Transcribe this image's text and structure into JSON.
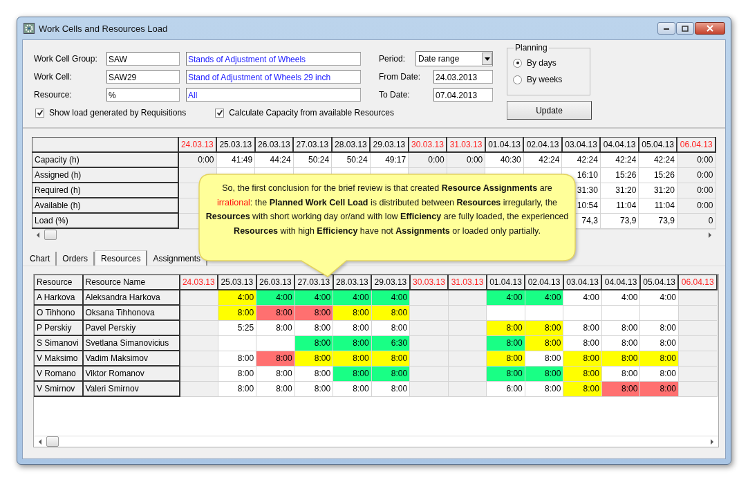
{
  "window": {
    "title": "Work Cells and Resources Load"
  },
  "filters": [
    {
      "label": "Work Cell Group:",
      "code": "SAW",
      "description": "Stands of Adjustment of Wheels"
    },
    {
      "label": "Work Cell:",
      "code": "SAW29",
      "description": "Stand of Adjustment of Wheels 29 inch"
    },
    {
      "label": "Resource:",
      "code": "%",
      "description": "All"
    }
  ],
  "checkboxes": [
    {
      "label": "Show load generated by Requisitions",
      "checked": true
    },
    {
      "label": "Calculate Capacity from available Resources",
      "checked": true
    }
  ],
  "period": {
    "label": "Period:",
    "value": "Date range"
  },
  "dates": [
    {
      "label": "From Date:",
      "value": "24.03.2013"
    },
    {
      "label": "To Date:",
      "value": "07.04.2013"
    }
  ],
  "planning": {
    "title": "Planning",
    "options": [
      {
        "label": "By days",
        "selected": true
      },
      {
        "label": "By weeks",
        "selected": false
      }
    ]
  },
  "update_button": "Update",
  "summary_grid": {
    "columns": [
      {
        "date": "24.03.13",
        "weekend": true
      },
      {
        "date": "25.03.13",
        "weekend": false
      },
      {
        "date": "26.03.13",
        "weekend": false
      },
      {
        "date": "27.03.13",
        "weekend": false
      },
      {
        "date": "28.03.13",
        "weekend": false
      },
      {
        "date": "29.03.13",
        "weekend": false
      },
      {
        "date": "30.03.13",
        "weekend": true
      },
      {
        "date": "31.03.13",
        "weekend": true
      },
      {
        "date": "01.04.13",
        "weekend": false
      },
      {
        "date": "02.04.13",
        "weekend": false
      },
      {
        "date": "03.04.13",
        "weekend": false
      },
      {
        "date": "04.04.13",
        "weekend": false
      },
      {
        "date": "05.04.13",
        "weekend": false
      },
      {
        "date": "06.04.13",
        "weekend": true
      }
    ],
    "rows": [
      {
        "label": "Capacity (h)",
        "cells": [
          "0:00",
          "41:49",
          "44:24",
          "50:24",
          "50:24",
          "49:17",
          "0:00",
          "0:00",
          "40:30",
          "42:24",
          "42:24",
          "42:24",
          "42:24",
          "0:00"
        ]
      },
      {
        "label": "Assigned (h)",
        "cells": [
          null,
          null,
          null,
          null,
          null,
          null,
          null,
          null,
          null,
          null,
          "16:10",
          "15:26",
          "15:26",
          "0:00"
        ]
      },
      {
        "label": "Required (h)",
        "cells": [
          null,
          null,
          null,
          null,
          null,
          null,
          null,
          null,
          null,
          null,
          "31:30",
          "31:20",
          "31:20",
          "0:00"
        ]
      },
      {
        "label": "Available (h)",
        "cells": [
          null,
          null,
          null,
          null,
          null,
          null,
          null,
          null,
          null,
          null,
          "10:54",
          "11:04",
          "11:04",
          "0:00"
        ]
      },
      {
        "label": "Load (%)",
        "cells": [
          null,
          null,
          null,
          null,
          null,
          null,
          null,
          null,
          null,
          null,
          "74,3",
          "73,9",
          "73,9",
          "0"
        ]
      }
    ]
  },
  "callout": [
    {
      "text": "So, the first conclusion for the brief review is that created ",
      "kind": "plain"
    },
    {
      "text": "Resource Assignments",
      "kind": "bold"
    },
    {
      "text": " are ",
      "kind": "plain"
    },
    {
      "text": "irrational",
      "kind": "alert"
    },
    {
      "text": ":  the ",
      "kind": "plain"
    },
    {
      "text": "Planned  Work Cell Load",
      "kind": "bold"
    },
    {
      "text": " is distributed between ",
      "kind": "plain"
    },
    {
      "text": "Resources",
      "kind": "bold"
    },
    {
      "text": " irregularly, the ",
      "kind": "plain"
    },
    {
      "text": "Resources",
      "kind": "bold"
    },
    {
      "text": " with short working day or/and with low ",
      "kind": "plain"
    },
    {
      "text": "Efficiency",
      "kind": "bold"
    },
    {
      "text": " are fully loaded, the experienced ",
      "kind": "plain"
    },
    {
      "text": "Resources",
      "kind": "bold"
    },
    {
      "text": " with high ",
      "kind": "plain"
    },
    {
      "text": "Efficiency",
      "kind": "bold"
    },
    {
      "text": " have not ",
      "kind": "plain"
    },
    {
      "text": "Assignments",
      "kind": "bold"
    },
    {
      "text": " or loaded only partially.",
      "kind": "plain"
    }
  ],
  "tabs": [
    {
      "label": "Chart",
      "selected": false
    },
    {
      "label": "Orders",
      "selected": false
    },
    {
      "label": "Resources",
      "selected": true
    },
    {
      "label": "Assignments",
      "selected": false
    }
  ],
  "resource_grid": {
    "headers": [
      "Resource",
      "Resource Name"
    ],
    "columns": [
      {
        "date": "24.03.13",
        "weekend": true
      },
      {
        "date": "25.03.13",
        "weekend": false
      },
      {
        "date": "26.03.13",
        "weekend": false
      },
      {
        "date": "27.03.13",
        "weekend": false
      },
      {
        "date": "28.03.13",
        "weekend": false
      },
      {
        "date": "29.03.13",
        "weekend": false
      },
      {
        "date": "30.03.13",
        "weekend": true
      },
      {
        "date": "31.03.13",
        "weekend": true
      },
      {
        "date": "01.04.13",
        "weekend": false
      },
      {
        "date": "02.04.13",
        "weekend": false
      },
      {
        "date": "03.04.13",
        "weekend": false
      },
      {
        "date": "04.04.13",
        "weekend": false
      },
      {
        "date": "05.04.13",
        "weekend": false
      },
      {
        "date": "06.04.13",
        "weekend": true
      }
    ],
    "rows": [
      {
        "resource": "A Harkova",
        "name": "Aleksandra Harkova",
        "cells": [
          null,
          {
            "text": "4:00",
            "color": "#ffff00"
          },
          {
            "text": "4:00",
            "color": "#19ff85"
          },
          {
            "text": "4:00",
            "color": "#19ff85"
          },
          {
            "text": "4:00",
            "color": "#19ff85"
          },
          {
            "text": "4:00",
            "color": "#19ff85"
          },
          null,
          null,
          {
            "text": "4:00",
            "color": "#19ff85"
          },
          {
            "text": "4:00",
            "color": "#19ff85"
          },
          {
            "text": "4:00",
            "color": "#ffffff"
          },
          {
            "text": "4:00",
            "color": "#ffffff"
          },
          {
            "text": "4:00",
            "color": "#ffffff"
          },
          null
        ]
      },
      {
        "resource": "O Tihhono",
        "name": "Oksana Tihhonova",
        "cells": [
          null,
          {
            "text": "8:00",
            "color": "#ffff00"
          },
          {
            "text": "8:00",
            "color": "#ff7070"
          },
          {
            "text": "8:00",
            "color": "#ff7070"
          },
          {
            "text": "8:00",
            "color": "#ffff00"
          },
          {
            "text": "8:00",
            "color": "#ffff00"
          },
          null,
          null,
          {
            "color": "#ffffff"
          },
          {
            "color": "#ffffff"
          },
          {
            "color": "#ffffff"
          },
          {
            "color": "#ffffff"
          },
          {
            "color": "#ffffff"
          },
          null
        ]
      },
      {
        "resource": "P Perskiy",
        "name": "Pavel Perskiy",
        "cells": [
          null,
          {
            "text": "5:25",
            "color": "#ffffff"
          },
          {
            "text": "8:00",
            "color": "#ffffff"
          },
          {
            "text": "8:00",
            "color": "#ffffff"
          },
          {
            "text": "8:00",
            "color": "#ffffff"
          },
          {
            "text": "8:00",
            "color": "#ffffff"
          },
          null,
          null,
          {
            "text": "8:00",
            "color": "#ffff00"
          },
          {
            "text": "8:00",
            "color": "#ffff00"
          },
          {
            "text": "8:00",
            "color": "#ffffff"
          },
          {
            "text": "8:00",
            "color": "#ffffff"
          },
          {
            "text": "8:00",
            "color": "#ffffff"
          },
          null
        ]
      },
      {
        "resource": "S Simanovi",
        "name": "Svetlana Simanovicius",
        "cells": [
          null,
          {
            "color": "#ffffff"
          },
          {
            "color": "#ffffff"
          },
          {
            "text": "8:00",
            "color": "#19ff85"
          },
          {
            "text": "8:00",
            "color": "#19ff85"
          },
          {
            "text": "6:30",
            "color": "#19ff85"
          },
          null,
          null,
          {
            "text": "8:00",
            "color": "#19ff85"
          },
          {
            "text": "8:00",
            "color": "#ffff00"
          },
          {
            "text": "8:00",
            "color": "#ffffff"
          },
          {
            "text": "8:00",
            "color": "#ffffff"
          },
          {
            "text": "8:00",
            "color": "#ffffff"
          },
          null
        ]
      },
      {
        "resource": "V Maksimo",
        "name": "Vadim Maksimov",
        "cells": [
          null,
          {
            "text": "8:00",
            "color": "#ffffff"
          },
          {
            "text": "8:00",
            "color": "#ff7070"
          },
          {
            "text": "8:00",
            "color": "#ffff00"
          },
          {
            "text": "8:00",
            "color": "#ffff00"
          },
          {
            "text": "8:00",
            "color": "#ffff00"
          },
          null,
          null,
          {
            "text": "8:00",
            "color": "#ffff00"
          },
          {
            "text": "8:00",
            "color": "#ffffff"
          },
          {
            "text": "8:00",
            "color": "#ffff00"
          },
          {
            "text": "8:00",
            "color": "#ffff00"
          },
          {
            "text": "8:00",
            "color": "#ffff00"
          },
          null
        ]
      },
      {
        "resource": "V Romano",
        "name": "Viktor Romanov",
        "cells": [
          null,
          {
            "text": "8:00",
            "color": "#ffffff"
          },
          {
            "text": "8:00",
            "color": "#ffffff"
          },
          {
            "text": "8:00",
            "color": "#ffffff"
          },
          {
            "text": "8:00",
            "color": "#19ff85"
          },
          {
            "text": "8:00",
            "color": "#19ff85"
          },
          null,
          null,
          {
            "text": "8:00",
            "color": "#19ff85"
          },
          {
            "text": "8:00",
            "color": "#19ff85"
          },
          {
            "text": "8:00",
            "color": "#ffff00"
          },
          {
            "text": "8:00",
            "color": "#ffffff"
          },
          {
            "text": "8:00",
            "color": "#ffffff"
          },
          null
        ]
      },
      {
        "resource": "V Smirnov",
        "name": "Valeri Smirnov",
        "cells": [
          null,
          {
            "text": "8:00",
            "color": "#ffffff"
          },
          {
            "text": "8:00",
            "color": "#ffffff"
          },
          {
            "text": "8:00",
            "color": "#ffffff"
          },
          {
            "text": "8:00",
            "color": "#ffffff"
          },
          {
            "text": "8:00",
            "color": "#ffffff"
          },
          null,
          null,
          {
            "text": "6:00",
            "color": "#ffffff"
          },
          {
            "text": "8:00",
            "color": "#ffffff"
          },
          {
            "text": "8:00",
            "color": "#ffff00"
          },
          {
            "text": "8:00",
            "color": "#ff7070"
          },
          {
            "text": "8:00",
            "color": "#ff7070"
          },
          null
        ]
      }
    ]
  }
}
